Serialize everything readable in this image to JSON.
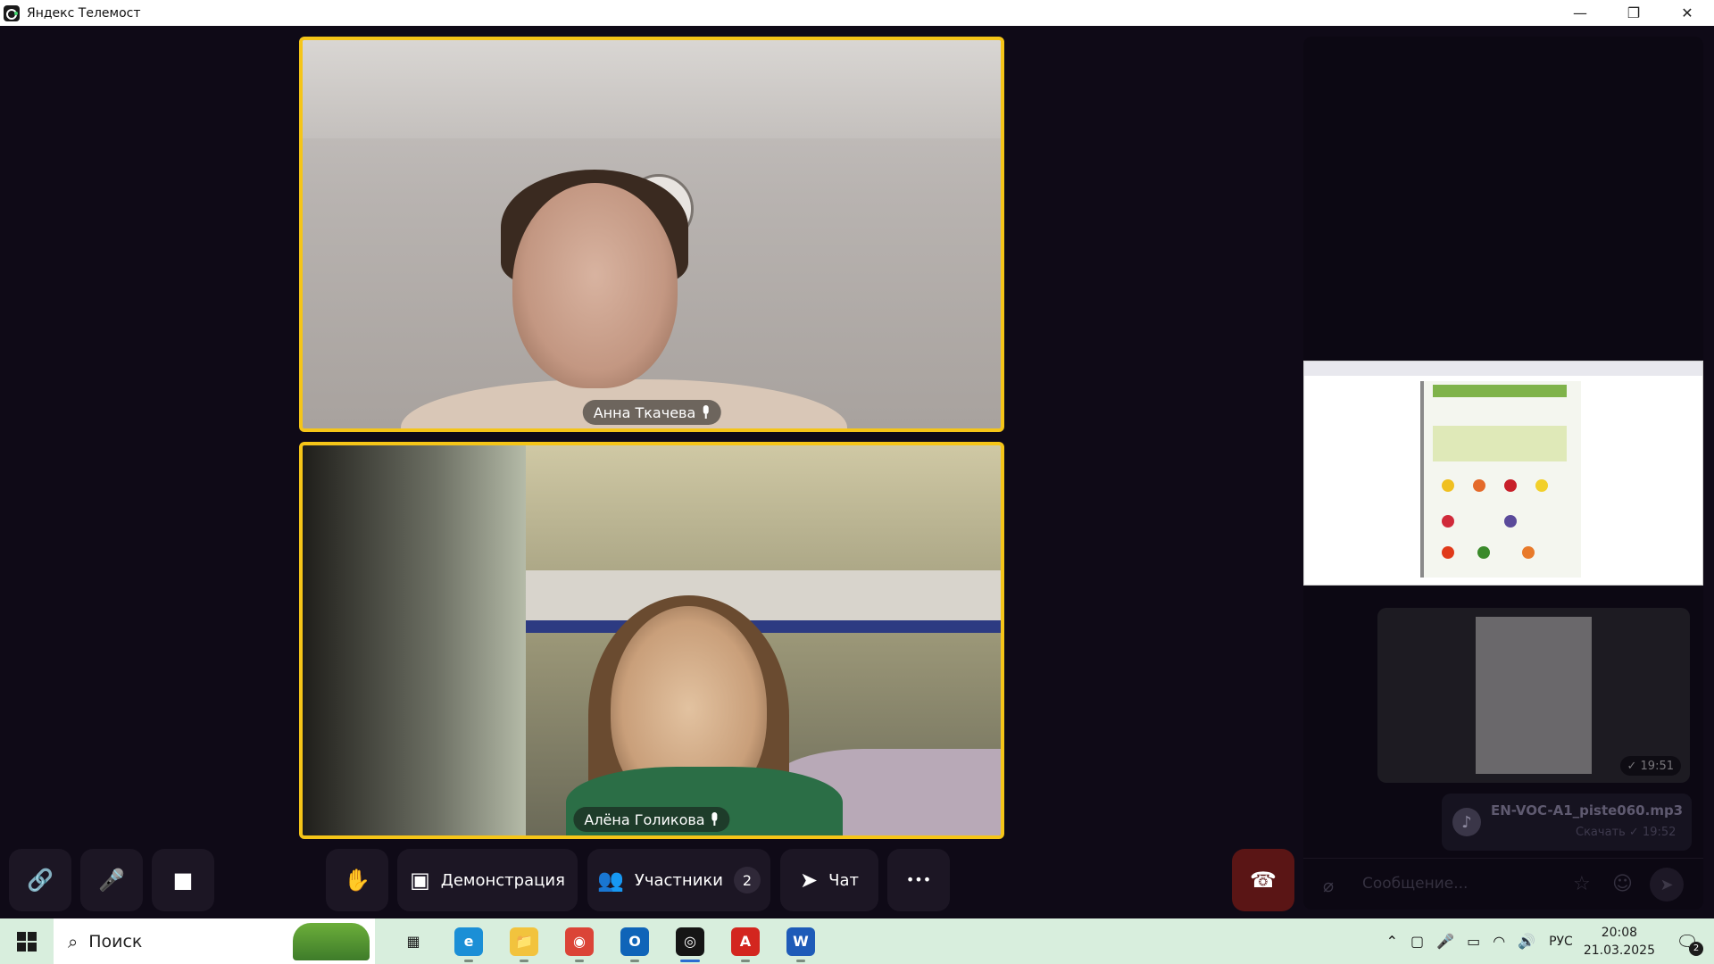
{
  "window": {
    "title": "Яндекс Телемост",
    "minimize": "—",
    "restore": "❐",
    "close": "✕"
  },
  "participants": [
    {
      "name": "Анна Ткачева"
    },
    {
      "name": "Алёна Голикова"
    }
  ],
  "chat": {
    "image_time": "✓ 19:51",
    "file": {
      "name": "EN-VOC-A1_piste060.mp3",
      "meta": "Скачать ✓ 19:52"
    },
    "input_placeholder": "Сообщение..."
  },
  "controls": {
    "link_icon": "🔗",
    "mic_icon": "🎤",
    "camera_icon": "■",
    "hand_icon": "✋",
    "demo_label": "Демонстрация",
    "participants_label": "Участники",
    "participants_count": "2",
    "chat_label": "Чат",
    "more_icon": "•••",
    "end_icon": "☎"
  },
  "taskbar": {
    "search_placeholder": "Поиск",
    "apps": [
      {
        "name": "task-view",
        "label": "▦",
        "color": "#d8eedd",
        "fg": "#1b1b1b"
      },
      {
        "name": "edge",
        "label": "e",
        "color": "#1b8fd6",
        "fg": "#ffffff"
      },
      {
        "name": "explorer",
        "label": "📁",
        "color": "#f2c33d",
        "fg": "#7a5a10"
      },
      {
        "name": "chrome",
        "label": "◉",
        "color": "#db4437",
        "fg": "#ffffff"
      },
      {
        "name": "outlook",
        "label": "O",
        "color": "#0f64b8",
        "fg": "#ffffff"
      },
      {
        "name": "telemost",
        "label": "◎",
        "color": "#151515",
        "fg": "#ffffff"
      },
      {
        "name": "acrobat",
        "label": "A",
        "color": "#d3261f",
        "fg": "#ffffff"
      },
      {
        "name": "word",
        "label": "W",
        "color": "#1e5bb8",
        "fg": "#ffffff"
      }
    ],
    "language": "РУС",
    "time": "20:08",
    "date": "21.03.2025",
    "notifications": "2"
  }
}
